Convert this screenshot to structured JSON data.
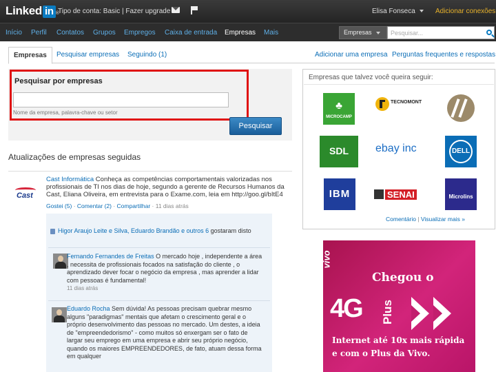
{
  "header": {
    "logo_text": "Linked",
    "logo_in": "in",
    "logo_reg": "®",
    "account_type": "Tipo de conta: Basic",
    "separator": " | ",
    "upgrade_link": "Fazer upgrade",
    "user_name": "Elisa Fonseca",
    "add_connections": "Adicionar conexões"
  },
  "nav": {
    "items": [
      "Início",
      "Perfil",
      "Contatos",
      "Grupos",
      "Empregos",
      "Caixa de entrada",
      "Empresas",
      "Mais"
    ],
    "active": "Empresas",
    "search_scope": "Empresas",
    "search_placeholder": "Pesquisar..."
  },
  "tabs": {
    "active": "Empresas",
    "items": [
      "Pesquisar empresas",
      "Seguindo (1)"
    ],
    "right_links": [
      "Adicionar uma empresa",
      "Perguntas frequentes e respostas"
    ]
  },
  "search_panel": {
    "title": "Pesquisar por empresas",
    "input_value": "",
    "hint": "Nome da empresa, palavra-chave ou setor",
    "button": "Pesquisar"
  },
  "updates": {
    "section_title": "Atualizações de empresas seguidas",
    "post": {
      "company_logo_text": "Cast",
      "company": "Cast Informática",
      "text": " Conheça as competências comportamentais valorizadas nos profissionais de TI nos dias de hoje, segundo a gerente de Recursos Humanos da Cast, Eliana Oliveira, em entrevista para o Exame.com, leia em http://goo.gl/bItE4",
      "actions": {
        "share": "Gostei (5)",
        "comment": "Comentar (2)",
        "sharelink": "Compartilhar",
        "sep": " · ",
        "time": "11 dias atrás"
      },
      "likes": {
        "names": "Higor Araujo Leite e Silva, Eduardo Brandão e outros 6",
        "rest": " gostaram disto"
      },
      "comments": [
        {
          "author": "Fernando Fernandes de Freitas",
          "text": " O mercado hoje , independente a área , necessita de profissionais focados na satisfação do cliente , o aprendizado dever focar o negócio da empresa , mas aprender a lidar com pessoas é fundamental!",
          "time": "11 dias atrás"
        },
        {
          "author": "Eduardo Rocha",
          "text": " Sem dúvida! As pessoas precisam quebrar mesmo alguns \"paradigmas\" mentais que afetam o crescimento geral e o próprio desenvolvimento das pessoas no mercado. Um destes, a ideia de \"empreendedorismo\" - como muitos só enxergam ser o fato de largar seu emprego em uma empresa e abrir seu próprio negócio, quando os maiores EMPREENDEDORES, de fato, atuam dessa forma em qualquer"
        }
      ]
    }
  },
  "suggestions": {
    "title": "Empresas que talvez você queira seguir:",
    "companies": [
      {
        "name": "Microcamp",
        "label": "MICROCAMP",
        "bg": "#3aa535",
        "fg": "#ffffff"
      },
      {
        "name": "Tecnomont",
        "label": "TECNOMONT",
        "bg": "#ffffff",
        "fg": "#222222"
      },
      {
        "name": "Suggested company",
        "label": "",
        "bg": "#ffffff",
        "fg": "#8c7a5c"
      },
      {
        "name": "SDL",
        "label": "SDL",
        "bg": "#2b8a2b",
        "fg": "#ffffff"
      },
      {
        "name": "eBay Inc",
        "label": "ebay inc",
        "bg": "#ffffff",
        "fg": "#1c6ec5"
      },
      {
        "name": "Dell",
        "label": "DELL",
        "bg": "#0a6db6",
        "fg": "#ffffff"
      },
      {
        "name": "IBM",
        "label": "IBM",
        "bg": "#1f3e9c",
        "fg": "#ffffff"
      },
      {
        "name": "SENAI",
        "label": "SENAI",
        "bg": "#ffffff",
        "fg": "#d41f26"
      },
      {
        "name": "Microlins",
        "label": "Microlins",
        "bg": "#2c2a8c",
        "fg": "#ffffff"
      }
    ],
    "footer_comment": "Comentário",
    "footer_sep": " | ",
    "footer_all": "Visualizar mais »"
  },
  "ad": {
    "brand": "vivo",
    "headline": "Chegou o",
    "big": "4G",
    "plus": "Plus",
    "line1": "Internet até 10x mais rápida",
    "line2": "e com o Plus da Vivo."
  }
}
